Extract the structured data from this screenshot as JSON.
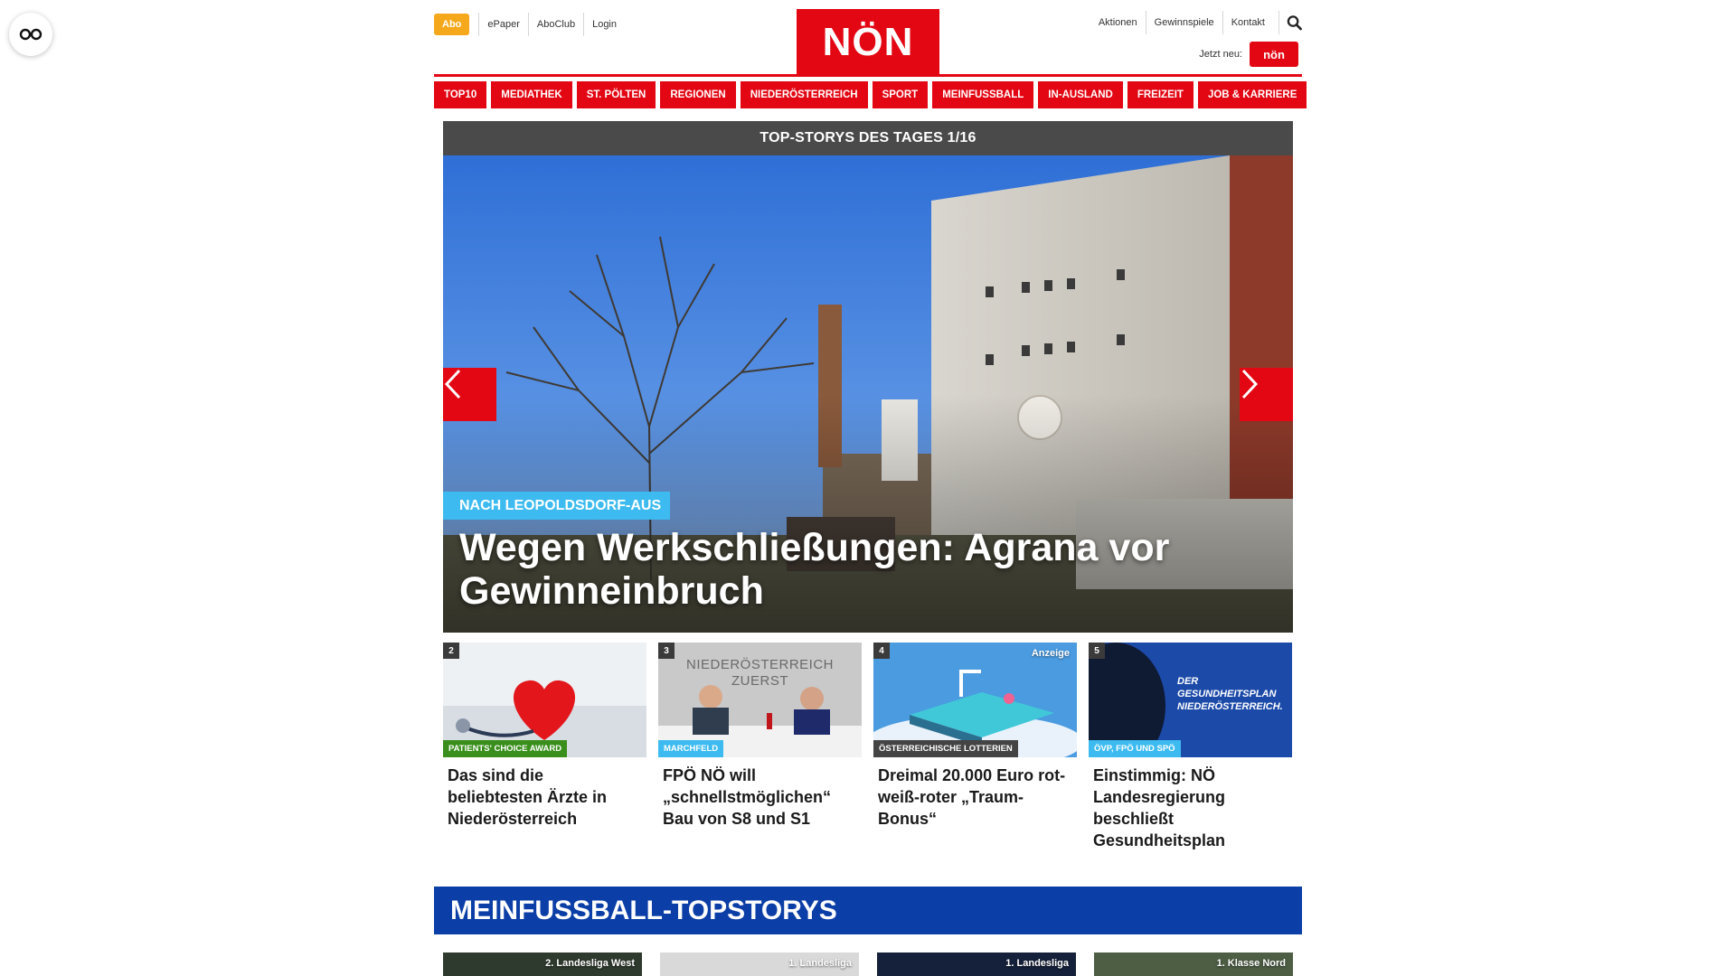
{
  "topnav": {
    "abo": "Abo",
    "left_links": [
      "ePaper",
      "AboClub",
      "Login"
    ],
    "right_links": [
      "Aktionen",
      "Gewinnspiele",
      "Kontakt"
    ],
    "jetzt_neu": "Jetzt neu:"
  },
  "logo": "NÖN",
  "promo_label": "nön",
  "mainnav": [
    "TOP10",
    "MEDIATHEK",
    "ST. PÖLTEN",
    "REGIONEN",
    "NIEDERÖSTERREICH",
    "SPORT",
    "MEINFUSSBALL",
    "IN-AUSLAND",
    "FREIZEIT",
    "JOB & KARRIERE"
  ],
  "slider": {
    "header": "TOP-STORYS DES TAGES 1/16",
    "kicker": "NACH LEOPOLDSDORF-AUS",
    "title": "Wegen Werkschließungen: Agrana vor Gewinneinbruch"
  },
  "cards": [
    {
      "num": "2",
      "tag": "PATIENTS' CHOICE AWARD",
      "tag_color": "#3a8f1c",
      "title": "Das sind die beliebtesten Ärzte in Niederösterreich",
      "anzeige": ""
    },
    {
      "num": "3",
      "tag": "MARCHFELD",
      "tag_color": "#3dbbf0",
      "title": "FPÖ NÖ will „schnellstmöglichen“ Bau von S8 und S1",
      "anzeige": "",
      "img_text": "NIEDERÖSTERREICH ZUERST"
    },
    {
      "num": "4",
      "tag": "ÖSTERREICHISCHE LOTTERIEN",
      "tag_color": "#444444",
      "title": "Dreimal 20.000 Euro rot-weiß-roter „Traum-Bonus“",
      "anzeige": "Anzeige"
    },
    {
      "num": "5",
      "tag": "ÖVP, FPÖ UND SPÖ",
      "tag_color": "#3dbbf0",
      "title": "Einstimmig: NÖ Landesregierung beschließt Gesundheitsplan",
      "anzeige": "",
      "img_text": "DER GESUNDHEITSPLAN NIEDERÖSTERREICH."
    }
  ],
  "fussball": {
    "header": "MEINFUSSBALL-TOPSTORYS",
    "cards": [
      "2. Landesliga West",
      "1. Landesliga",
      "1. Landesliga",
      "1. Klasse Nord"
    ]
  },
  "colors": {
    "brand_red": "#e30613",
    "abo_orange": "#f6a81c",
    "kicker_blue": "#3dbbf0",
    "fussball_blue": "#0b3ea6"
  }
}
